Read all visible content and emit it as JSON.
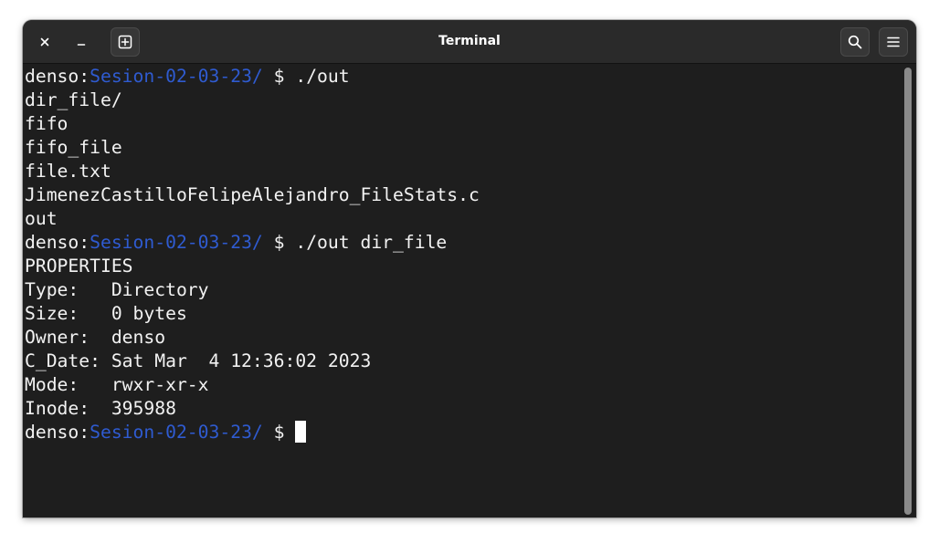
{
  "window": {
    "title": "Terminal"
  },
  "header": {
    "close_icon": "close-icon",
    "minimize_icon": "minimize-icon",
    "new_tab_icon": "new-tab-icon",
    "search_icon": "search-icon",
    "menu_icon": "hamburger-menu-icon"
  },
  "colors": {
    "background": "#1e1e1e",
    "headerbar": "#2a2a2a",
    "text": "#f2f2f2",
    "prompt_path": "#2f5bd0"
  },
  "prompt": {
    "user": "denso:",
    "path": "Sesion-02-03-23/",
    "symbol": " $ "
  },
  "lines": [
    {
      "kind": "prompt",
      "cmd": "./out"
    },
    {
      "kind": "text",
      "text": "dir_file/"
    },
    {
      "kind": "text",
      "text": "fifo"
    },
    {
      "kind": "text",
      "text": "fifo_file"
    },
    {
      "kind": "text",
      "text": "file.txt"
    },
    {
      "kind": "text",
      "text": "JimenezCastilloFelipeAlejandro_FileStats.c"
    },
    {
      "kind": "text",
      "text": "out"
    },
    {
      "kind": "prompt",
      "cmd": "./out dir_file"
    },
    {
      "kind": "text",
      "text": "PROPERTIES"
    },
    {
      "kind": "text",
      "text": "Type:   Directory"
    },
    {
      "kind": "text",
      "text": "Size:   0 bytes"
    },
    {
      "kind": "text",
      "text": "Owner:  denso"
    },
    {
      "kind": "text",
      "text": "C_Date: Sat Mar  4 12:36:02 2023"
    },
    {
      "kind": "text",
      "text": "Mode:   rwxr-xr-x"
    },
    {
      "kind": "text",
      "text": "Inode:  395988"
    },
    {
      "kind": "prompt",
      "cmd": "",
      "cursor": true
    }
  ]
}
